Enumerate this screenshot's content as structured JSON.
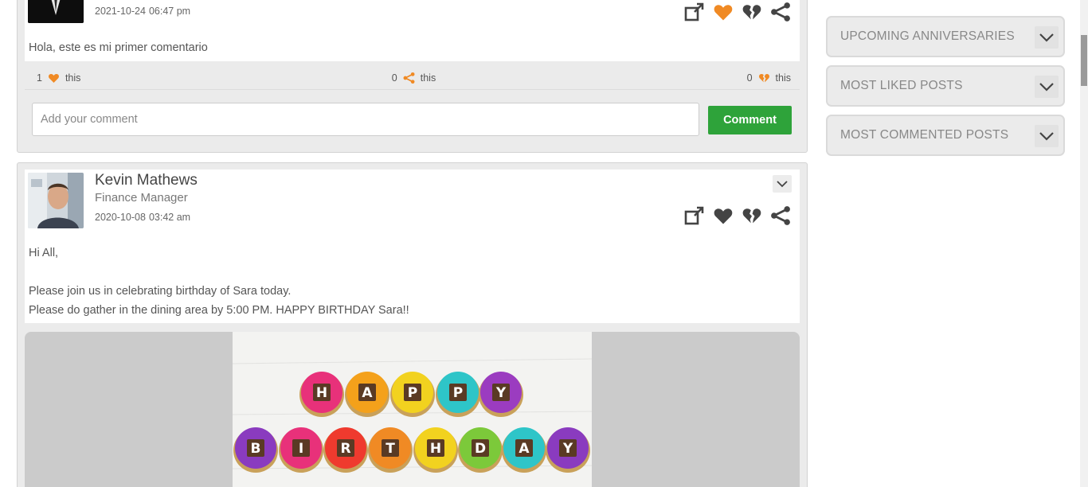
{
  "posts": [
    {
      "date": "2021-10-24",
      "time": "06:47 pm",
      "text": "Hola, este es mi primer comentario",
      "liked": true,
      "stats": {
        "likes_count": "1",
        "likes_suffix": "this",
        "shares_count": "0",
        "shares_suffix": "this",
        "dislikes_count": "0",
        "dislikes_suffix": "this"
      },
      "comment_placeholder": "Add your comment",
      "comment_button": "Comment"
    },
    {
      "author_name": "Kevin Mathews",
      "author_role": "Finance Manager",
      "date": "2020-10-08",
      "time": "03:42 am",
      "liked": false,
      "text_lines": [
        "Hi All,",
        "Please join us in celebrating birthday of Sara today.",
        "Please do gather in the dining area by 5:00 PM. HAPPY BIRTHDAY Sara!!"
      ],
      "image_letters_row1": [
        "H",
        "A",
        "P",
        "P",
        "Y"
      ],
      "image_letters_row2": [
        "B",
        "I",
        "R",
        "T",
        "H",
        "D",
        "A",
        "Y"
      ]
    }
  ],
  "sidebar": {
    "widgets": [
      {
        "title": "UPCOMING ANNIVERSARIES"
      },
      {
        "title": "MOST LIKED POSTS"
      },
      {
        "title": "MOST COMMENTED POSTS"
      }
    ]
  },
  "colors": {
    "accent_orange": "#f08a24",
    "icon_gray": "#444444",
    "comment_green": "#2ea33a"
  }
}
